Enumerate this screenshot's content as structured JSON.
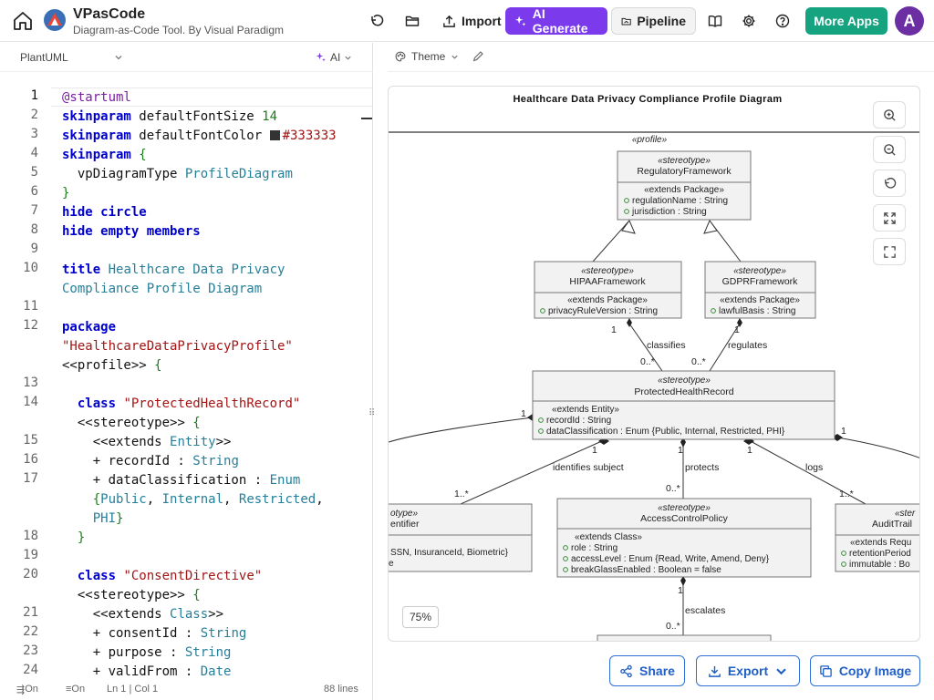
{
  "app": {
    "name": "VPasCode",
    "subtitle": "Diagram-as-Code Tool. By Visual Paradigm",
    "avatar_initial": "A"
  },
  "toolbar": {
    "import_label": "Import",
    "ai_generate_label": "AI Generate",
    "pipeline_label": "Pipeline",
    "more_apps_label": "More Apps"
  },
  "editor": {
    "language": "PlantUML",
    "ai_label": "AI",
    "line_numbers": [
      "1",
      "2",
      "3",
      "4",
      "5",
      "6",
      "7",
      "8",
      "9",
      "10",
      "11",
      "12",
      "13",
      "14",
      "15",
      "16",
      "17",
      "18",
      "19",
      "20",
      "21",
      "22",
      "23",
      "24"
    ],
    "status_wrap": "On",
    "status_minimap": "On",
    "cursor_position": "Ln 1 | Col 1",
    "total_lines": "88 lines"
  },
  "preview": {
    "theme_label": "Theme",
    "zoom_level": "75%",
    "share_label": "Share",
    "export_label": "Export",
    "copy_image_label": "Copy Image"
  },
  "diagram": {
    "title": "Healthcare Data Privacy Compliance Profile Diagram",
    "profile_label": "«profile»",
    "stereotype_label": "«stereotype»",
    "classes": {
      "regulatory": {
        "name": "RegulatoryFramework",
        "extends": "«extends Package»",
        "attrs": [
          "regulationName : String",
          "jurisdiction : String"
        ]
      },
      "hipaa": {
        "name": "HIPAAFramework",
        "extends": "«extends Package»",
        "attrs": [
          "privacyRuleVersion : String"
        ]
      },
      "gdpr": {
        "name": "GDPRFramework",
        "extends": "«extends Package»",
        "attrs": [
          "lawfulBasis : String"
        ]
      },
      "phr": {
        "name": "ProtectedHealthRecord",
        "extends": "«extends Entity»",
        "attrs": [
          "recordId : String",
          "dataClassification : Enum {Public, Internal, Restricted, PHI}"
        ]
      },
      "acp": {
        "name": "AccessControlPolicy",
        "extends": "«extends Class»",
        "attrs": [
          "role : String",
          "accessLevel : Enum {Read, Write, Amend, Deny}",
          "breakGlassEnabled : Boolean = false"
        ]
      },
      "identifier": {
        "stereotype": "otype»",
        "name": "entifier",
        "attr_line1": "SSN, InsuranceId, Biometric}",
        "attr_line2": "e"
      },
      "audit": {
        "stereotype": "«ster",
        "name": "AuditTrail",
        "extends": "«extends Requ",
        "attrs": [
          "retentionPeriod",
          "immutable : Bo"
        ]
      }
    },
    "labels": {
      "classifies": "classifies",
      "regulates": "regulates",
      "identifies_subject": "identifies subject",
      "protects": "protects",
      "logs": "logs",
      "escalates": "escalates",
      "one": "1",
      "zero_many": "0..*",
      "one_many": "1..*"
    }
  }
}
